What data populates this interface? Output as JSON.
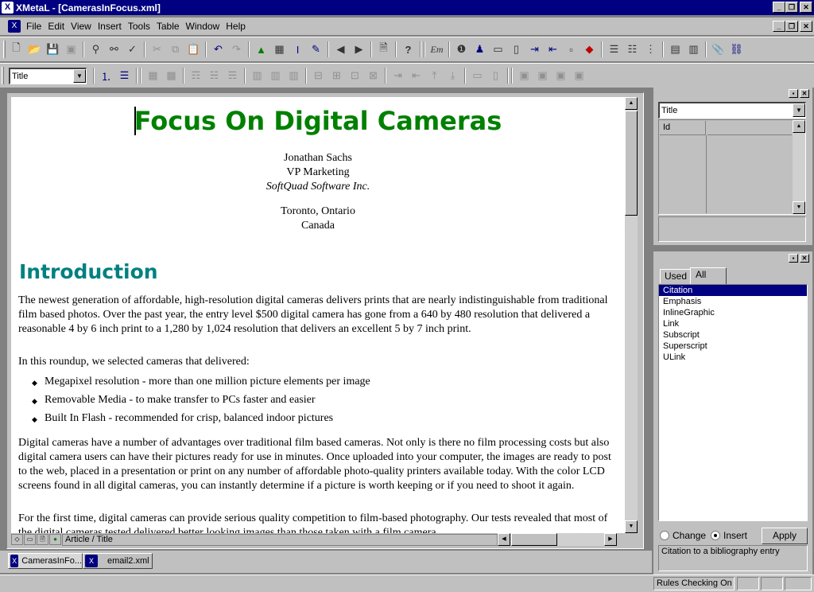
{
  "window": {
    "title": "XMetaL - [CamerasInFocus.xml]"
  },
  "menu": [
    "File",
    "Edit",
    "View",
    "Insert",
    "Tools",
    "Table",
    "Window",
    "Help"
  ],
  "toolbar": {
    "style_combo_value": "Title",
    "emphasis_label": "Em"
  },
  "document": {
    "title": "Focus On Digital Cameras",
    "author_name": "Jonathan Sachs",
    "author_title": "VP Marketing",
    "author_company": "SoftQuad Software Inc.",
    "location_city": "Toronto, Ontario",
    "location_country": "Canada",
    "section_heading": "Introduction",
    "para1": "The newest generation of affordable, high-resolution digital cameras delivers prints that are nearly indistinguishable from traditional film based photos. Over the past year, the entry level $500 digital camera has gone from a 640 by 480 resolution that delivered a reasonable 4 by 6 inch print to a 1,280 by 1,024 resolution that delivers an excellent 5 by 7 inch print.",
    "para2": "In this roundup, we selected cameras that delivered:",
    "bullets": [
      "Megapixel resolution - more than one million picture elements per image",
      "Removable Media - to make transfer to PCs faster and easier",
      "Built In Flash - recommended for crisp, balanced indoor pictures"
    ],
    "para3": "Digital cameras have a number of advantages over traditional film based cameras. Not only is there no film processing costs but also digital camera users can have their pictures ready for use in minutes. Once uploaded into your computer, the images are ready to post to the web, placed in a presentation or print on any number of affordable photo-quality printers available today. With the color LCD screens found in all digital cameras, you can instantly determine if a picture is worth keeping or if you need to shoot it again.",
    "para4": "For the first time, digital cameras can provide serious quality competition to film-based photography. Our tests revealed that most of the digital cameras tested delivered better looking images than those taken with a film camera"
  },
  "doc_status": {
    "path": "Article / Title"
  },
  "doc_tabs": [
    "CamerasInFo...",
    "email2.xml"
  ],
  "attributes_panel": {
    "element_combo": "Title",
    "attr_name": "Id",
    "attr_value": ""
  },
  "elements_panel": {
    "tabs": [
      "Used",
      "All"
    ],
    "active_tab": "All",
    "items": [
      "Citation",
      "Emphasis",
      "InlineGraphic",
      "Link",
      "Subscript",
      "Superscript",
      "ULink"
    ],
    "selected": "Citation",
    "change_label": "Change",
    "insert_label": "Insert",
    "mode": "Insert",
    "apply_label": "Apply",
    "description": "Citation to a bibliography entry"
  },
  "status_bar": {
    "rules_checking": "Rules Checking On"
  }
}
